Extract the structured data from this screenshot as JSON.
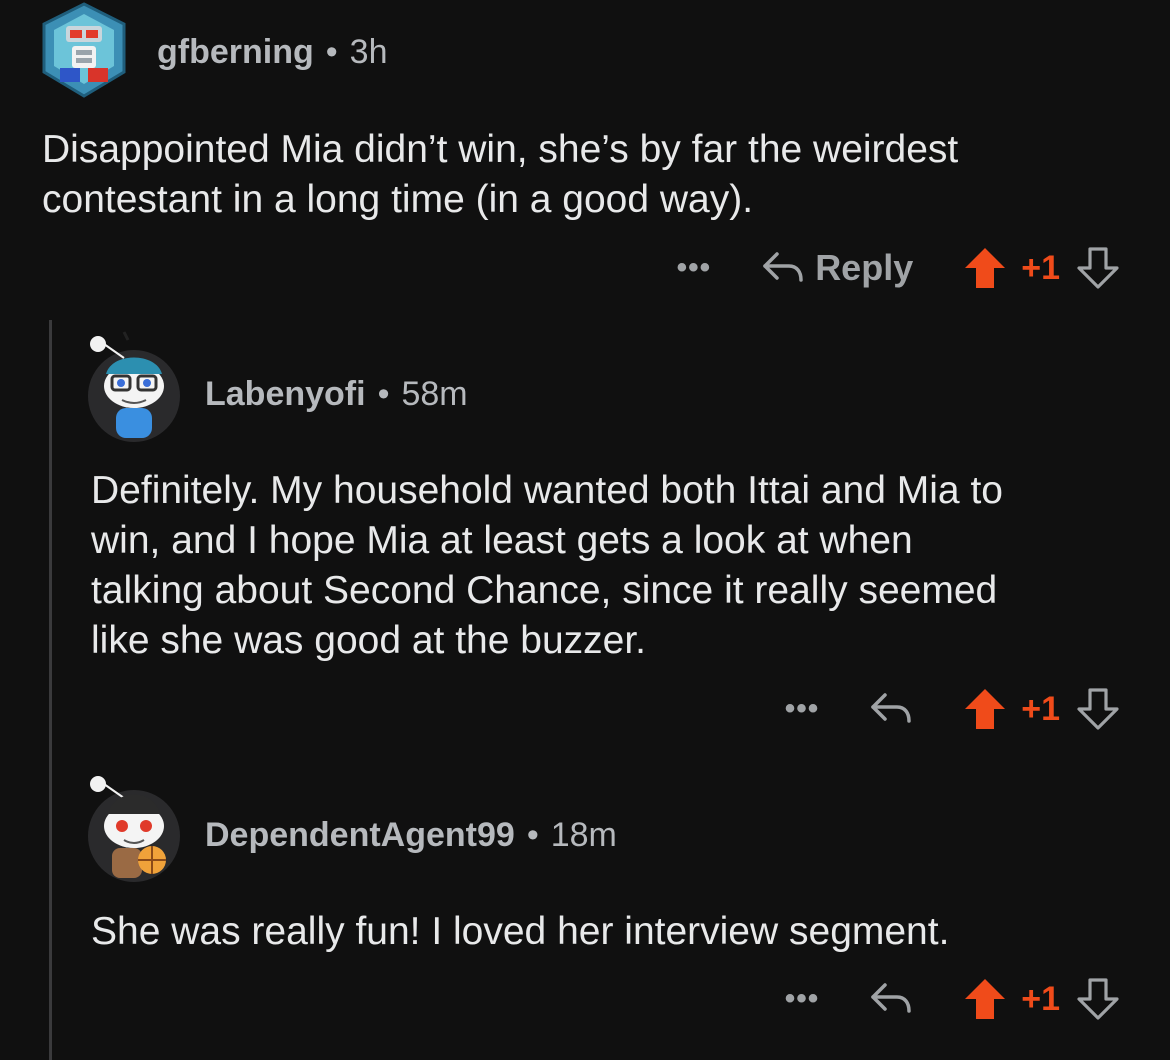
{
  "colors": {
    "background": "#101010",
    "text": "#e8e9ea",
    "meta": "#b6b9bd",
    "upvote_accent": "#f04b1a",
    "thread_line": "#3a3a3c"
  },
  "comments": [
    {
      "username": "gfberning",
      "separator": "•",
      "time": "3h",
      "body": "Disappointed Mia didn’t win, she’s by far the weirdest\ncontestant in a long time (in a good way).",
      "more_label": "•••",
      "reply_label": "Reply",
      "score": "+1",
      "upvoted": true,
      "avatar_icon": "robot-avatar-icon"
    },
    {
      "username": "Labenyofi",
      "separator": "•",
      "time": "58m",
      "body": "Definitely. My household wanted both Ittai and Mia to\nwin, and I hope Mia at least gets a look at when\ntalking about Second Chance, since it really seemed\nlike she was good at the buzzer.",
      "more_label": "•••",
      "score": "+1",
      "upvoted": true,
      "avatar_icon": "snoo-glasses-avatar-icon"
    },
    {
      "username": "DependentAgent99",
      "separator": "•",
      "time": "18m",
      "body": "She was really fun! I loved her interview segment.",
      "more_label": "•••",
      "score": "+1",
      "upvoted": true,
      "avatar_icon": "snoo-basketball-avatar-icon"
    }
  ]
}
